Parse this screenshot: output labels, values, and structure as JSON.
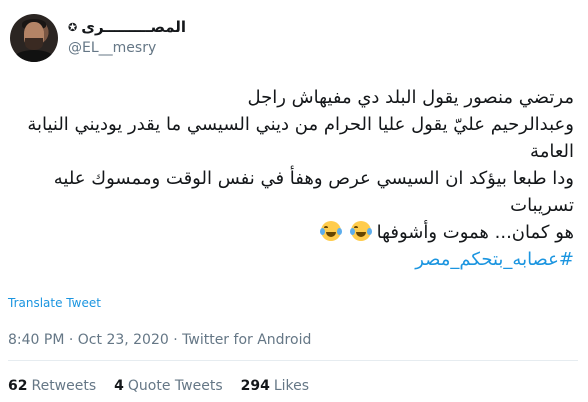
{
  "author": {
    "display_name": "المصـــــــــرى",
    "badge_symbol": "✪",
    "handle": "@EL__mesry"
  },
  "tweet": {
    "lines": [
      "مرتضي منصور يقول البلد دي مفيهاش راجل",
      "وعبدالرحيم عليّ يقول عليا الحرام من ديني السيسي ما يقدر يوديني النيابة العامة",
      "ودا طبعا بيؤكد ان السيسي عرص وهفأ في نفس الوقت وممسوك عليه تسريبات",
      "هو كمان... هموت وأشوفها"
    ],
    "hashtag": "#عصابه_بتحكم_مصر"
  },
  "translate_label": "Translate Tweet",
  "meta": {
    "time": "8:40 PM",
    "separator": "·",
    "date": "Oct 23, 2020",
    "client": "Twitter for Android"
  },
  "stats": {
    "retweets_count": "62",
    "retweets_label": "Retweets",
    "quotes_count": "4",
    "quotes_label": "Quote Tweets",
    "likes_count": "294",
    "likes_label": "Likes"
  },
  "colors": {
    "link": "#1b95e0",
    "muted": "#657786",
    "text": "#14171a"
  }
}
